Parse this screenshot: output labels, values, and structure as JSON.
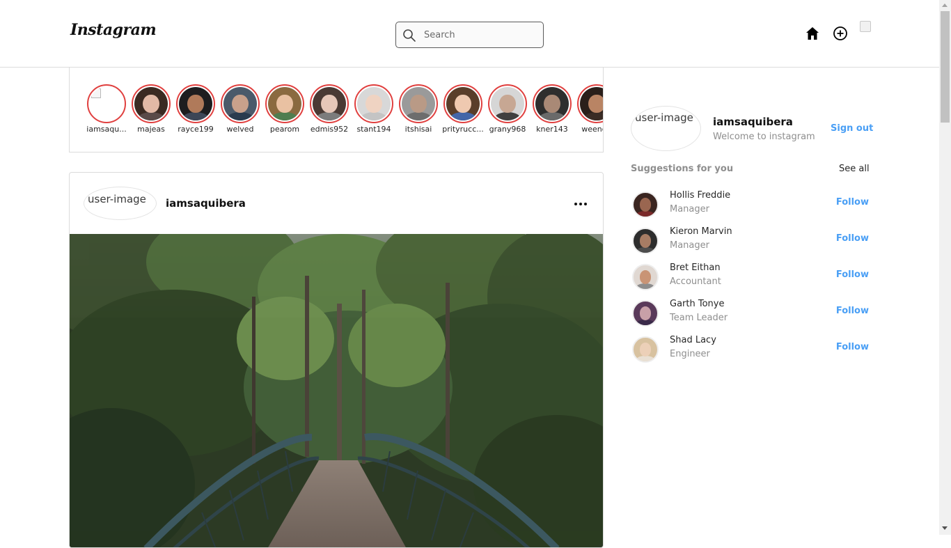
{
  "header": {
    "logo": "Instagram",
    "search_placeholder": "Search"
  },
  "stories": [
    {
      "name": "iamsaqu...",
      "placeholder": true
    },
    {
      "name": "majeas",
      "hair": "#3b2a22",
      "skin": "#e2b9a6",
      "body": "#5a4a48"
    },
    {
      "name": "rayce199",
      "hair": "#1d1d1f",
      "skin": "#b07a5a",
      "body": "#3d4656"
    },
    {
      "name": "welved",
      "hair": "#4b5a6a",
      "skin": "#c9a18b",
      "body": "#2a3b4e"
    },
    {
      "name": "pearom",
      "hair": "#8a6a40",
      "skin": "#e9c1a2",
      "body": "#4f7d4f"
    },
    {
      "name": "edmis952",
      "hair": "#4a3a34",
      "skin": "#e6c7b8",
      "body": "#7c7c7c"
    },
    {
      "name": "stant194",
      "hair": "#d8d8d8",
      "skin": "#efd3c2",
      "body": "#c4c4c4"
    },
    {
      "name": "itshisai",
      "hair": "#9a9a9a",
      "skin": "#b99a86",
      "body": "#6d6d6d"
    },
    {
      "name": "prityrucc...",
      "hair": "#5a3e2a",
      "skin": "#efc9b0",
      "body": "#4466a8"
    },
    {
      "name": "grany968",
      "hair": "#d6d6d6",
      "skin": "#c7a793",
      "body": "#404040"
    },
    {
      "name": "kner143",
      "hair": "#2e2e2e",
      "skin": "#a98976",
      "body": "#6a6a6a"
    },
    {
      "name": "weendu",
      "hair": "#2a1f1a",
      "skin": "#b98464",
      "body": "#3a2c25"
    }
  ],
  "post": {
    "avatar_alt": "user-image",
    "username": "iamsaquibera",
    "more_icon": "more-horizontal-icon"
  },
  "profile": {
    "avatar_alt": "user-image",
    "username": "iamsaquibera",
    "subtitle": "Welcome to instagram",
    "signout": "Sign out"
  },
  "suggestions": {
    "title": "Suggestions for you",
    "see_all": "See all",
    "follow_label": "Follow",
    "items": [
      {
        "name": "Hollis Freddie",
        "role": "Manager",
        "hair": "#3a2520",
        "skin": "#9a6650",
        "body": "#7a2a2a"
      },
      {
        "name": "Kieron Marvin",
        "role": "Manager",
        "hair": "#2d2d2d",
        "skin": "#a77c64",
        "body": "#4d4d4d"
      },
      {
        "name": "Bret Eithan",
        "role": "Accountant",
        "hair": "#e0d8d2",
        "skin": "#c99475",
        "body": "#8d8d8d"
      },
      {
        "name": "Garth Tonye",
        "role": "Team Leader",
        "hair": "#5a3a5a",
        "skin": "#c8a0a8",
        "body": "#3a2a4a"
      },
      {
        "name": "Shad Lacy",
        "role": "Engineer",
        "hair": "#d8c2a0",
        "skin": "#ecd0b8",
        "body": "#e9e0d4"
      }
    ]
  },
  "colors": {
    "story_ring": "#e0403f",
    "link_blue": "#4a9ff5",
    "border": "#dbdbdb"
  }
}
